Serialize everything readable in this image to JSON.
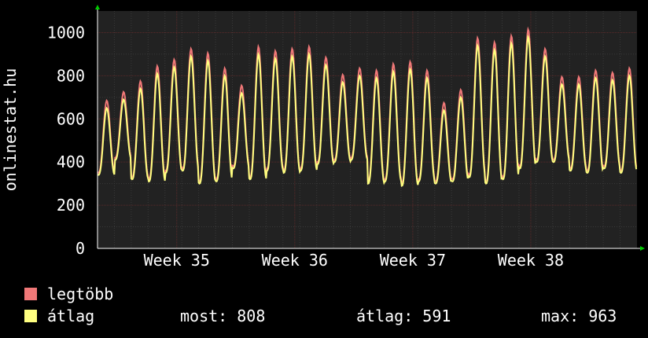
{
  "colors": {
    "background": "#000000",
    "plot_background": "#222222",
    "grid_major": "#5a2a2a",
    "grid_minor": "#3a3a3a",
    "text": "#ffffff",
    "axis_arrow": "#00cc00",
    "series_max": "#f07878",
    "series_avg": "#ffff80"
  },
  "legend": {
    "items": [
      {
        "label": "legtöbb",
        "color": "#f07878"
      },
      {
        "label": "átlag",
        "color": "#ffff80"
      }
    ]
  },
  "stats": {
    "current": "most: 808",
    "average": "átlag: 591",
    "maximum": "max: 963"
  },
  "chart_data": {
    "type": "line",
    "title": "",
    "xlabel": "",
    "ylabel": "onlinestat.hu",
    "ylim": [
      0,
      1100
    ],
    "yticks": [
      0,
      200,
      400,
      600,
      800,
      1000
    ],
    "xlim": [
      0,
      32
    ],
    "xticks": [
      {
        "label": "Week 35",
        "at": 4.7
      },
      {
        "label": "Week 36",
        "at": 11.7
      },
      {
        "label": "Week 37",
        "at": 18.7
      },
      {
        "label": "Week 38",
        "at": 25.7
      }
    ],
    "grid": true,
    "legend_position": "bottom-left",
    "daily_avg_min": [
      340,
      410,
      320,
      310,
      350,
      360,
      300,
      310,
      370,
      320,
      360,
      350,
      360,
      390,
      400,
      410,
      300,
      310,
      290,
      310,
      300,
      310,
      330,
      300,
      320,
      370,
      400,
      400,
      360,
      350,
      370,
      350
    ],
    "daily_avg_max": [
      650,
      690,
      740,
      810,
      840,
      890,
      870,
      800,
      720,
      900,
      880,
      890,
      900,
      850,
      770,
      800,
      790,
      820,
      830,
      790,
      640,
      700,
      940,
      920,
      950,
      980,
      890,
      760,
      760,
      790,
      780,
      800
    ],
    "max_offset": 35,
    "series": [
      {
        "name": "legtöbb",
        "color": "#f07878",
        "key": "max"
      },
      {
        "name": "átlag",
        "color": "#ffff80",
        "key": "avg"
      }
    ]
  }
}
